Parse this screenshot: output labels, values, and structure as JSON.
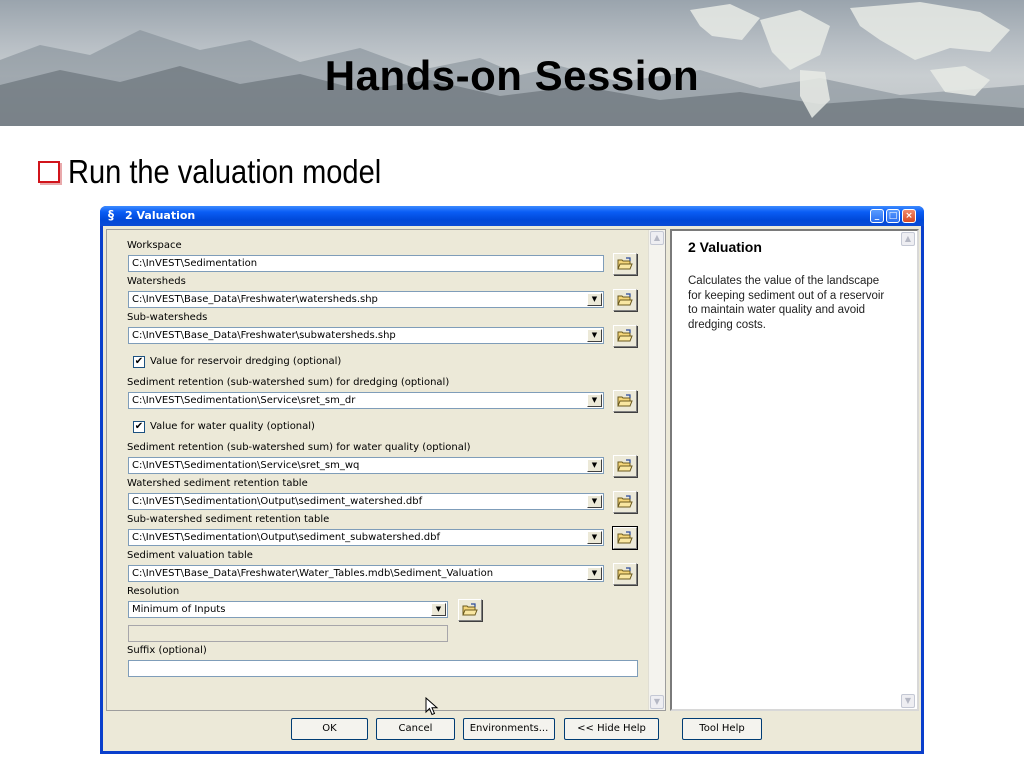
{
  "slide": {
    "title": "Hands-on Session",
    "bullet": "Run the valuation model"
  },
  "window": {
    "title": "2 Valuation"
  },
  "form": {
    "workspace": {
      "label": "Workspace",
      "value": "C:\\InVEST\\Sedimentation"
    },
    "watersheds": {
      "label": "Watersheds",
      "value": "C:\\InVEST\\Base_Data\\Freshwater\\watersheds.shp"
    },
    "sub_watersheds": {
      "label": "Sub-watersheds",
      "value": "C:\\InVEST\\Base_Data\\Freshwater\\subwatersheds.shp"
    },
    "dredging_check": {
      "label": "Value for reservoir dredging (optional)",
      "checked": true,
      "mark": "✔"
    },
    "sret_dredging": {
      "label": "Sediment retention (sub-watershed sum) for dredging (optional)",
      "value": "C:\\InVEST\\Sedimentation\\Service\\sret_sm_dr"
    },
    "water_quality_check": {
      "label": "Value for water quality (optional)",
      "checked": true,
      "mark": "✔"
    },
    "sret_water_quality": {
      "label": "Sediment retention (sub-watershed sum) for water quality (optional)",
      "value": "C:\\InVEST\\Sedimentation\\Service\\sret_sm_wq"
    },
    "ws_retention_table": {
      "label": "Watershed sediment retention table",
      "value": "C:\\InVEST\\Sedimentation\\Output\\sediment_watershed.dbf"
    },
    "sws_retention_table": {
      "label": "Sub-watershed sediment retention table",
      "value": "C:\\InVEST\\Sedimentation\\Output\\sediment_subwatershed.dbf"
    },
    "valuation_table": {
      "label": "Sediment valuation table",
      "value": "C:\\InVEST\\Base_Data\\Freshwater\\Water_Tables.mdb\\Sediment_Valuation"
    },
    "resolution": {
      "label": "Resolution",
      "value": "Minimum of Inputs"
    },
    "suffix": {
      "label": "Suffix (optional)",
      "value": ""
    }
  },
  "help": {
    "title": "2 Valuation",
    "text": "Calculates the value of the landscape for keeping sediment out of a reservoir to maintain water quality and avoid dredging costs."
  },
  "buttons": {
    "ok": "OK",
    "cancel": "Cancel",
    "environments": "Environments...",
    "hide_help": "<< Hide Help",
    "tool_help": "Tool Help"
  },
  "icons": {
    "window": "model-tool-icon",
    "browse": "open-folder-icon",
    "dropdown": "chevron-down-icon",
    "cursor": "mouse-pointer-icon"
  },
  "colors": {
    "titlebar": "#0a5df5",
    "bullet": "#d1141b",
    "dialog_face": "#ece9d8"
  }
}
